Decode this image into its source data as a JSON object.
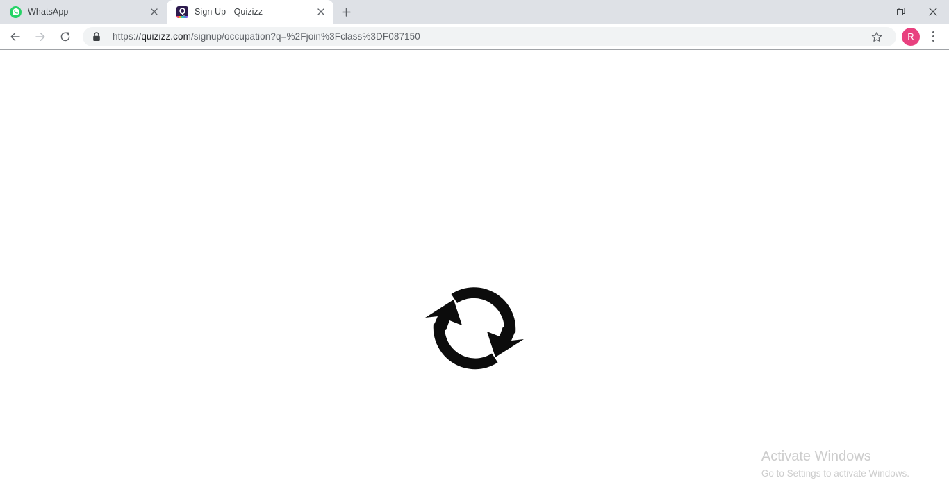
{
  "browser": {
    "name": "Google Chrome",
    "tabs": [
      {
        "title": "WhatsApp",
        "favicon": "whatsapp-icon",
        "active": false,
        "close_label": "×"
      },
      {
        "title": "Sign Up - Quizizz",
        "favicon": "quizizz-icon",
        "favicon_letter": "Q",
        "active": true,
        "close_label": "×"
      }
    ],
    "new_tab_label": "+",
    "window_controls": {
      "minimize_label": "—",
      "maximize_label": "❐",
      "close_label": "✕"
    },
    "toolbar": {
      "back_label": "←",
      "forward_label": "→",
      "reload_label": "↻",
      "site_security": "lock-icon",
      "url_scheme": "https://",
      "url_host": "quizizz.com",
      "url_path": "/signup/occupation?q=%2Fjoin%3Fclass%3DF087150",
      "url_full": "https://quizizz.com/signup/occupation?q=%2Fjoin%3Fclass%3DF087150",
      "bookmark_label": "☆",
      "profile_initial": "R",
      "profile_color": "#e8417f",
      "menu_label": "⋮"
    }
  },
  "page": {
    "title": "Sign Up - Quizizz",
    "state": "loading",
    "spinner": "sync-refresh-icon",
    "background_color": "#ffffff"
  },
  "watermark": {
    "title": "Activate Windows",
    "subtitle": "Go to Settings to activate Windows.",
    "color": "#cdcdcd"
  }
}
